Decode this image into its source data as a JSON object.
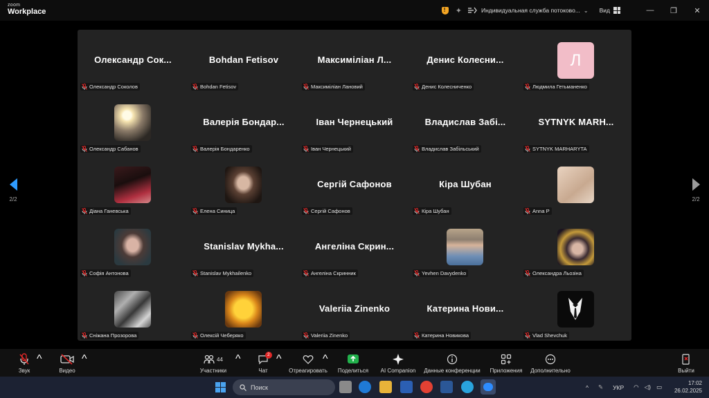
{
  "app": {
    "brand_top": "zoom",
    "brand_bottom": "Workplace"
  },
  "titlebar": {
    "meeting_title": "Индивидуальная служба потоково...",
    "view_label": "Вид"
  },
  "colors": {
    "active_arrow": "#2e9bff",
    "mute_red": "#e02828",
    "avatar_pink": "#f2bdc8"
  },
  "participants": [
    {
      "display": "Олександр  Сок...",
      "label": "Олександр Соколов",
      "type": "name"
    },
    {
      "display": "Bohdan Fetisov",
      "label": "Bohdan Fetisov",
      "type": "name"
    },
    {
      "display": "Максиміліан  Л...",
      "label": "Максиміліан Лановий",
      "type": "name"
    },
    {
      "display": "Денис  Колесни...",
      "label": "Денис Колесниченко",
      "type": "name"
    },
    {
      "display": "Л",
      "label": "Людмила Гетьманенко",
      "type": "letter"
    },
    {
      "display": "",
      "label": "Олександр Сабанов",
      "type": "photo",
      "photo": "sunset-silhouette"
    },
    {
      "display": "Валерія  Бондар...",
      "label": "Валерія Бондаренко",
      "type": "name"
    },
    {
      "display": "Іван Чернецький",
      "label": "Іван Чернецький",
      "type": "name"
    },
    {
      "display": "Владислав  Забі...",
      "label": "Владислав Забільський",
      "type": "name"
    },
    {
      "display": "SYTNYK  MARH...",
      "label": "SYTNYK MARHARYTA",
      "type": "name"
    },
    {
      "display": "",
      "label": "Діана Ганевська",
      "type": "photo",
      "photo": "portrait-red"
    },
    {
      "display": "",
      "label": "Елена Синица",
      "type": "photo",
      "photo": "portrait-dark"
    },
    {
      "display": "Сергій Сафонов",
      "label": "Сергій Сафонов",
      "type": "name"
    },
    {
      "display": "Кіра Шубан",
      "label": "Кіра Шубан",
      "type": "name"
    },
    {
      "display": "",
      "label": "Anna P",
      "type": "photo",
      "photo": "beige-closeup"
    },
    {
      "display": "",
      "label": "Софія Антонова",
      "type": "photo",
      "photo": "portrait-teal"
    },
    {
      "display": "Stanislav  Mykha...",
      "label": "Stanislav Mykhailenko",
      "type": "name"
    },
    {
      "display": "Ангеліна  Скрин...",
      "label": "Ангеліна Скринник",
      "type": "name"
    },
    {
      "display": "",
      "label": "Yevhen Davydenko",
      "type": "photo",
      "photo": "man-shirt"
    },
    {
      "display": "",
      "label": "Олександра Льозіна",
      "type": "photo",
      "photo": "eiffel-night"
    },
    {
      "display": "",
      "label": "Сніжана Прозорова",
      "type": "photo",
      "photo": "stickers"
    },
    {
      "display": "",
      "label": "Олексій Чеберяко",
      "type": "photo",
      "photo": "pikachu-detective"
    },
    {
      "display": "Valeriia Zinenko",
      "label": "Valeriia Zinenko",
      "type": "name"
    },
    {
      "display": "Катерина  Нови...",
      "label": "Катерина Новикова",
      "type": "name"
    },
    {
      "display": "",
      "label": "Vlad Shevchuk",
      "type": "photo",
      "photo": "tuxedo-black"
    }
  ],
  "pagination": {
    "left": "2/2",
    "right": "2/2"
  },
  "controls": {
    "audio": "Звук",
    "video": "Видео",
    "participants": "Участники",
    "participants_count": "44",
    "chat": "Чат",
    "chat_badge": "2",
    "reactions": "Отреагировать",
    "share": "Поделиться",
    "ai": "AI Companion",
    "meeting_info": "Данные конференции",
    "apps": "Приложения",
    "more": "Дополнительно",
    "leave": "Выйти"
  },
  "taskbar": {
    "search_placeholder": "Поиск",
    "language": "УКР",
    "time": "17:02",
    "date": "26.02.2025"
  }
}
